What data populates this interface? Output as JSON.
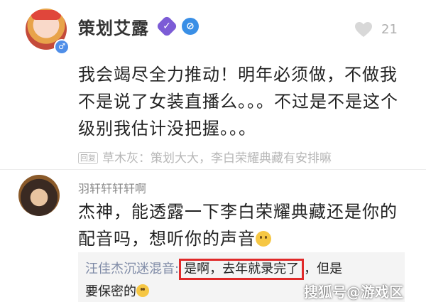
{
  "comment1": {
    "author": "策划艾露",
    "like_count": "21",
    "body": "我会竭尽全力推动！明年必须做，不做我不是说了女装直播么。。。不过是不是这个级别我估计没把握。。。",
    "reply_tag": "回复",
    "reply_preview": "草木灰：策划大大，李白荣耀典藏有安排嘛",
    "gender_symbol": "♂"
  },
  "comment2": {
    "author": "羽轩轩轩轩啊",
    "body": "杰神，能透露一下李白荣耀典藏还是你的配音吗，想听你的声音",
    "reply": {
      "author": "汪佳杰沉迷混音:",
      "highlighted_text": "是啊，去年就录完了",
      "rest": "，但是",
      "line2": "要保密的"
    }
  },
  "watermark": "搜狐号@游戏区",
  "colors": {
    "highlight_border": "#e02a2a",
    "verify_badge": "#7c5cd6",
    "compass_badge": "#3a8fe6",
    "reply_author": "#7e8aa6"
  }
}
